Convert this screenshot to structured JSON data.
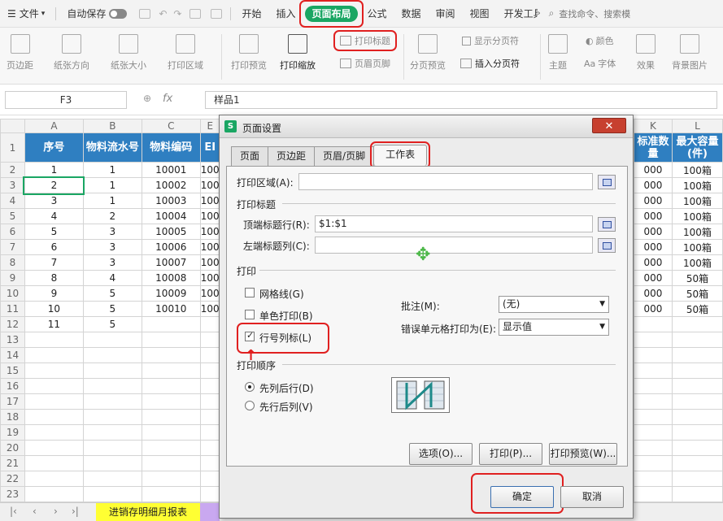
{
  "menubar": {
    "file": "文件",
    "autosave": "自动保存",
    "tabs": [
      "开始",
      "插入",
      "页面布局",
      "公式",
      "数据",
      "审阅",
      "视图",
      "开发工具"
    ],
    "search": "查找命令、搜索模"
  },
  "ribbon": {
    "margins": "页边距",
    "orientation": "纸张方向",
    "size": "纸张大小",
    "print_area": "打印区域",
    "print_preview": "打印预览",
    "print_scale": "打印缩放",
    "print_titles": "打印标题",
    "header_footer": "页眉页脚",
    "page_break_preview": "分页预览",
    "show_page_breaks": "显示分页符",
    "insert_page_break": "插入分页符",
    "theme": "主题",
    "colors": "颜色",
    "fonts": "字体",
    "effects": "效果",
    "background": "背景图片"
  },
  "formula_bar": {
    "cell_ref": "F3",
    "value": "样品1"
  },
  "grid": {
    "col_letters": [
      "A",
      "B",
      "C",
      "E",
      "K",
      "L"
    ],
    "headers": [
      "序号",
      "物料流水号",
      "物料编码",
      "EI",
      "标准数量",
      "最大容量(件)"
    ],
    "rows": [
      [
        "1",
        "1",
        "10001",
        "100",
        "000",
        "100箱"
      ],
      [
        "2",
        "1",
        "10002",
        "100",
        "000",
        "100箱"
      ],
      [
        "3",
        "1",
        "10003",
        "100",
        "000",
        "100箱"
      ],
      [
        "4",
        "2",
        "10004",
        "100",
        "000",
        "100箱"
      ],
      [
        "5",
        "3",
        "10005",
        "100",
        "000",
        "100箱"
      ],
      [
        "6",
        "3",
        "10006",
        "100",
        "000",
        "100箱"
      ],
      [
        "7",
        "3",
        "10007",
        "100",
        "000",
        "100箱"
      ],
      [
        "8",
        "4",
        "10008",
        "100",
        "000",
        "50箱"
      ],
      [
        "9",
        "5",
        "10009",
        "100",
        "000",
        "50箱"
      ],
      [
        "10",
        "5",
        "10010",
        "100",
        "000",
        "50箱"
      ],
      [
        "11",
        "5",
        "",
        "",
        "",
        ""
      ]
    ],
    "row_numbers": [
      "1",
      "2",
      "3",
      "4",
      "5",
      "6",
      "7",
      "8",
      "9",
      "10",
      "11",
      "12",
      "13",
      "14",
      "15",
      "16",
      "17",
      "18",
      "19",
      "20",
      "21",
      "22",
      "23"
    ]
  },
  "sheet": {
    "tab1": "进销存明细月报表"
  },
  "dialog": {
    "title": "页面设置",
    "close": "✕",
    "tabs": [
      "页面",
      "页边距",
      "页眉/页脚",
      "工作表"
    ],
    "print_area_label": "打印区域(A):",
    "print_titles_group": "打印标题",
    "top_rows_label": "顶端标题行(R):",
    "top_rows_value": "$1:$1",
    "left_cols_label": "左端标题列(C):",
    "print_group": "打印",
    "gridlines": "网格线(G)",
    "mono": "单色打印(B)",
    "row_col_headers": "行号列标(L)",
    "comments_label": "批注(M):",
    "comments_value": "(无)",
    "errors_label": "错误单元格打印为(E):",
    "errors_value": "显示值",
    "order_group": "打印顺序",
    "down_then_over": "先列后行(D)",
    "over_then_down": "先行后列(V)",
    "options_btn": "选项(O)...",
    "print_btn": "打印(P)...",
    "preview_btn": "打印预览(W)...",
    "ok_btn": "确定",
    "cancel_btn": "取消"
  }
}
